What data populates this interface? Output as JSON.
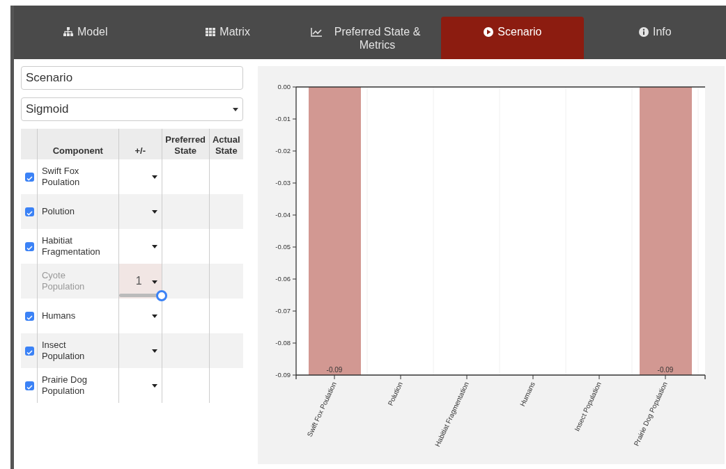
{
  "tabs": [
    {
      "label": "Model",
      "selected": false
    },
    {
      "label": "Matrix",
      "selected": false
    },
    {
      "label": "Preferred State & Metrics",
      "selected": false
    },
    {
      "label": "Scenario",
      "selected": true
    },
    {
      "label": "Info",
      "selected": false
    }
  ],
  "scenario_name": {
    "value": "Scenario"
  },
  "function_select": {
    "value": "Sigmoid"
  },
  "table": {
    "columns": [
      "Component",
      "+/-",
      "Preferred State",
      "Actual State"
    ],
    "rows": [
      {
        "component": "Swift Fox Poulation",
        "checked": true
      },
      {
        "component": "Polution",
        "checked": true
      },
      {
        "component": "Habitiat Fragmentation",
        "checked": true
      },
      {
        "component": "Cyote Population",
        "checked": false,
        "value": "1",
        "level": 1
      },
      {
        "component": "Humans",
        "checked": true
      },
      {
        "component": "Insect Population",
        "checked": true
      },
      {
        "component": "Prairie Dog Population",
        "checked": true
      }
    ]
  },
  "chart": {
    "chart_data": {
      "type": "bar",
      "categories": [
        "Swift Fox Poulation",
        "Polution",
        "Habitiat Fragmentation",
        "Humans",
        "Insect Population",
        "Prairie Dog Population"
      ],
      "series": [
        {
          "color": "#d29892",
          "values": [
            -0.09,
            0,
            0,
            0,
            0,
            -0.09
          ]
        }
      ],
      "ylim": [
        -0.09,
        0
      ],
      "yticks": [
        {
          "value": 0,
          "label": "0.00"
        },
        {
          "value": -0.01,
          "label": "-0.01"
        },
        {
          "value": -0.02,
          "label": "-0.02"
        },
        {
          "value": -0.03,
          "label": "-0.03"
        },
        {
          "value": -0.04,
          "label": "-0.04"
        },
        {
          "value": -0.05,
          "label": "-0.05"
        },
        {
          "value": -0.06,
          "label": "-0.06"
        },
        {
          "value": -0.07,
          "label": "-0.07"
        },
        {
          "value": -0.08,
          "label": "-0.08"
        },
        {
          "value": -0.09,
          "label": "-0.09"
        }
      ],
      "value_labels": [
        "-0.09",
        null,
        null,
        null,
        null,
        "-0.09"
      ]
    }
  }
}
